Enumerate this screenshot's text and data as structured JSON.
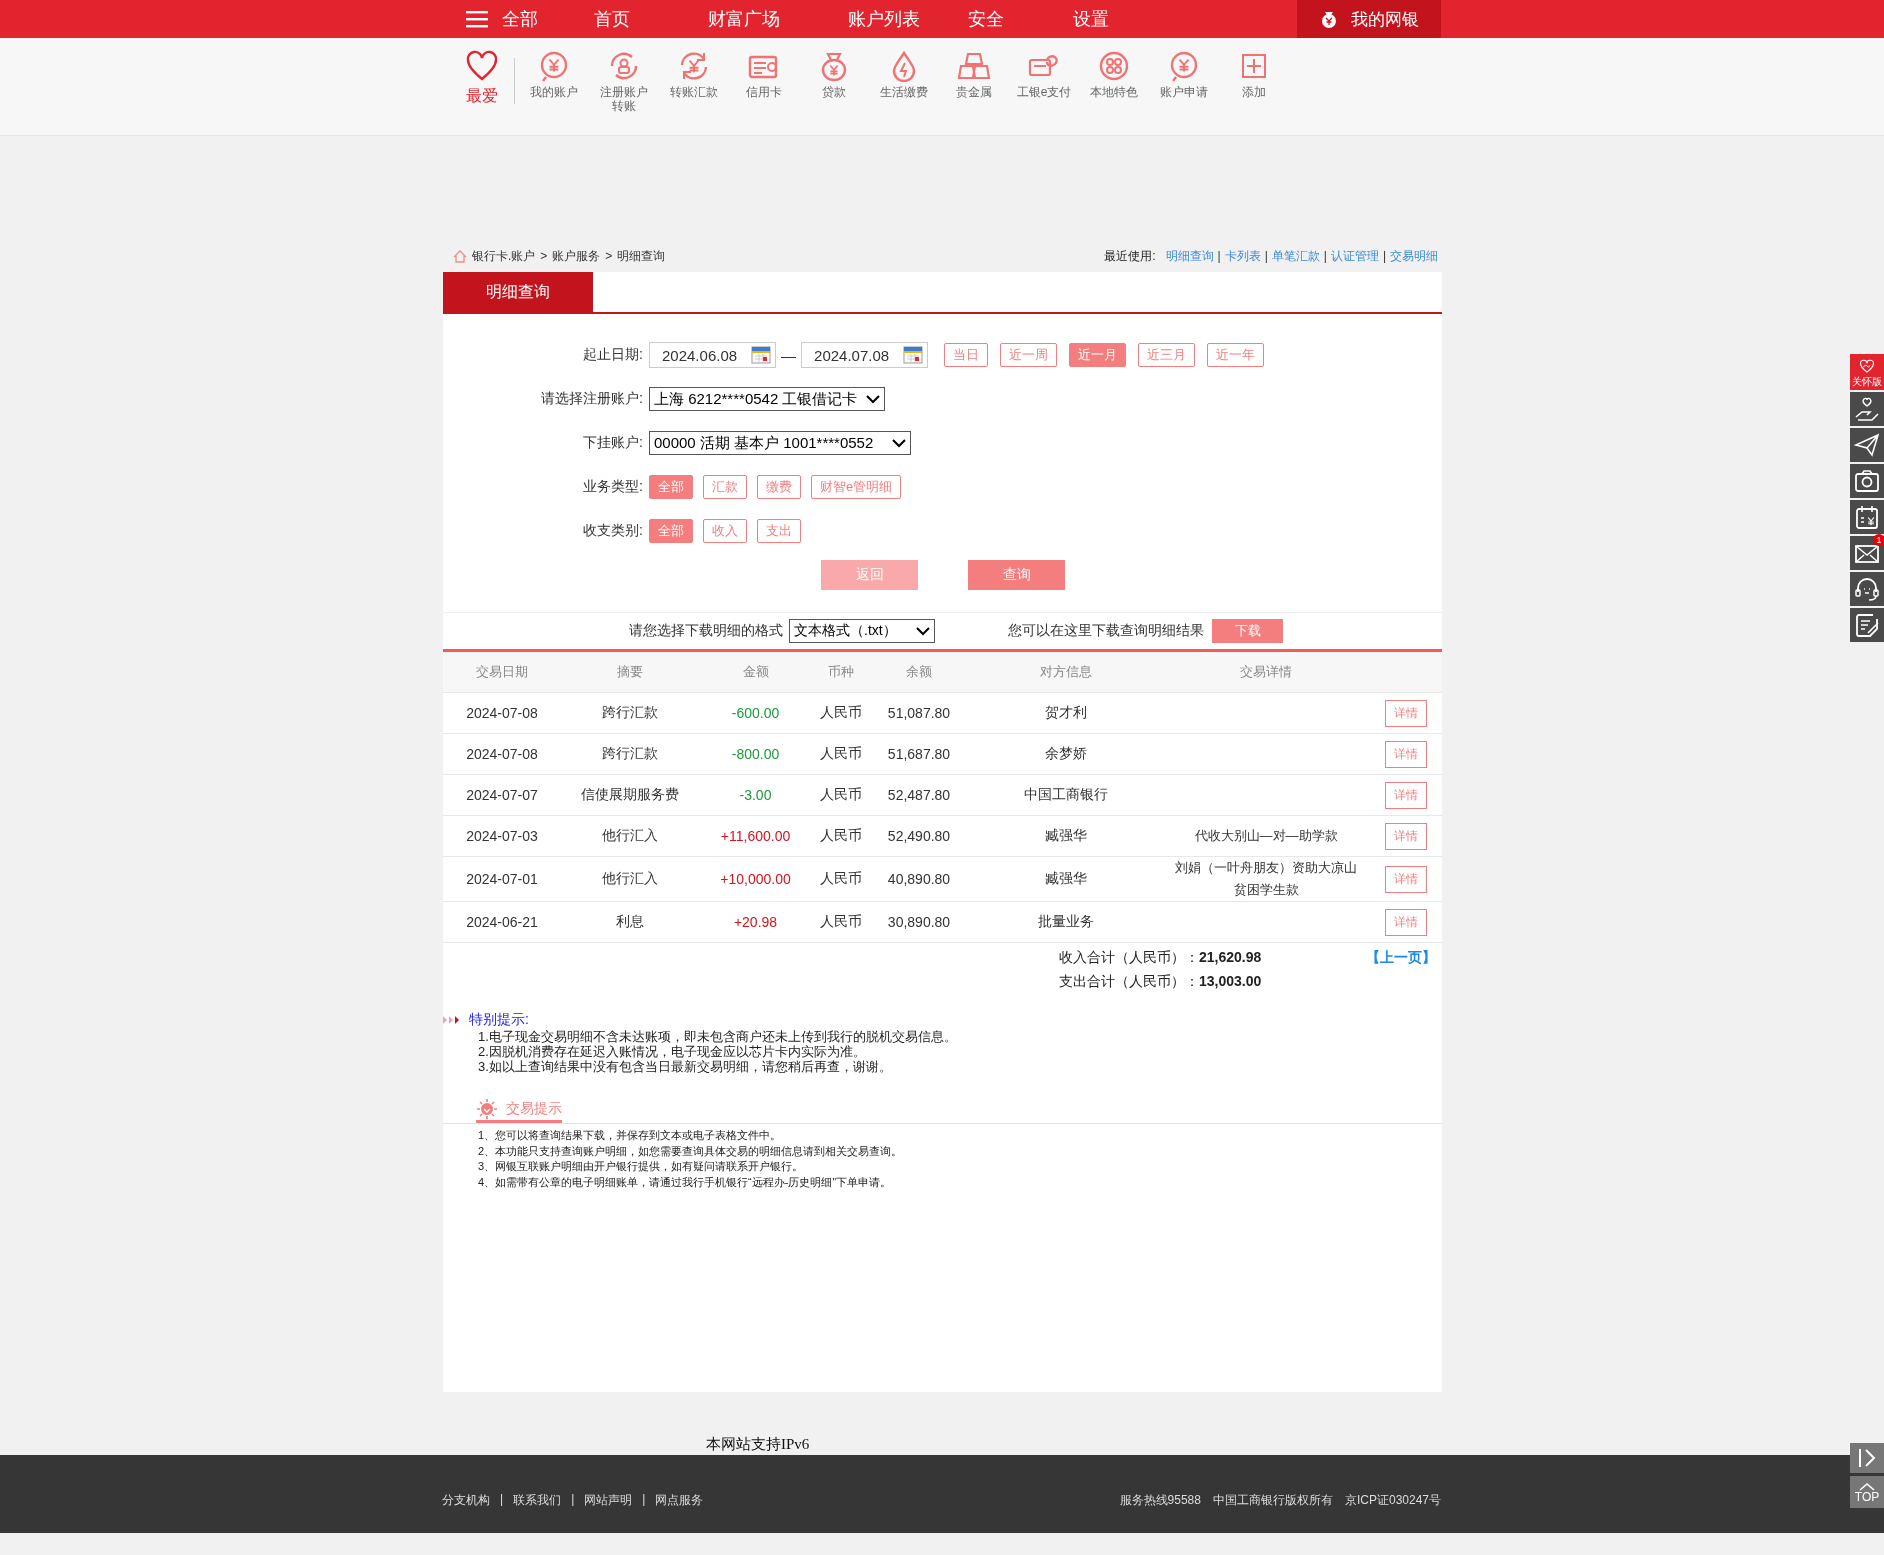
{
  "top_nav": {
    "menu_label": "全部",
    "items": [
      {
        "label": "首页"
      },
      {
        "label": "财富广场"
      },
      {
        "label": "账户列表"
      },
      {
        "label": "安全"
      },
      {
        "label": "设置"
      }
    ],
    "my_bank": "我的网银"
  },
  "quick_menu": {
    "favorite": "最爱",
    "items": [
      {
        "label": "我的账户"
      },
      {
        "label": "注册账户转账"
      },
      {
        "label": "转账汇款"
      },
      {
        "label": "信用卡"
      },
      {
        "label": "贷款"
      },
      {
        "label": "生活缴费"
      },
      {
        "label": "贵金属"
      },
      {
        "label": "工银e支付"
      },
      {
        "label": "本地特色"
      },
      {
        "label": "账户申请"
      },
      {
        "label": "添加"
      }
    ]
  },
  "breadcrumb": {
    "items": [
      "银行卡.账户",
      "账户服务",
      "明细查询"
    ],
    "separator": ">"
  },
  "recent": {
    "label": "最近使用:",
    "links": [
      "明细查询",
      "卡列表",
      "单笔汇款",
      "认证管理",
      "交易明细"
    ],
    "separator": "|"
  },
  "tabs": [
    {
      "label": "明细查询",
      "selected": true
    }
  ],
  "form": {
    "date_label": "起止日期:",
    "start_date": "2024.06.08",
    "dash": "—",
    "end_date": "2024.07.08",
    "ranges": [
      {
        "label": "当日",
        "selected": false
      },
      {
        "label": "近一周",
        "selected": false
      },
      {
        "label": "近一月",
        "selected": true
      },
      {
        "label": "近三月",
        "selected": false
      },
      {
        "label": "近一年",
        "selected": false
      }
    ],
    "account_label": "请选择注册账户:",
    "account": "上海 6212****0542 工银借记卡",
    "sub_account_label": "下挂账户:",
    "sub_account": "00000 活期 基本户 1001****0552",
    "biz_label": "业务类型:",
    "biz_types": [
      {
        "label": "全部",
        "selected": true
      },
      {
        "label": "汇款",
        "selected": false
      },
      {
        "label": "缴费",
        "selected": false
      },
      {
        "label": "财智e管明细",
        "selected": false
      }
    ],
    "io_label": "收支类别:",
    "io_types": [
      {
        "label": "全部",
        "selected": true
      },
      {
        "label": "收入",
        "selected": false
      },
      {
        "label": "支出",
        "selected": false
      }
    ],
    "buttons": [
      {
        "label": "返回",
        "disabled": true
      },
      {
        "label": "查询",
        "disabled": false
      }
    ]
  },
  "download": {
    "label": "请您选择下载明细的格式",
    "format": "文本格式（.txt）",
    "hint": "您可以在这里下载查询明细结果",
    "button": "下载"
  },
  "table": {
    "columns": [
      "交易日期",
      "摘要",
      "金额",
      "币种",
      "余额",
      "对方信息",
      "交易详情"
    ],
    "rows": [
      {
        "date": "2024-07-08",
        "summary": "跨行汇款",
        "amount": "-600.00",
        "color": "#1a9b3a",
        "currency": "人民币",
        "balance": "51,087.80",
        "counterparty": "贺才利",
        "action": "详情"
      },
      {
        "date": "2024-07-08",
        "summary": "跨行汇款",
        "amount": "-800.00",
        "color": "#1a9b3a",
        "currency": "人民币",
        "balance": "51,687.80",
        "counterparty": "余梦娇",
        "action": "详情"
      },
      {
        "date": "2024-07-07",
        "summary": "信使展期服务费",
        "amount": "-3.00",
        "color": "#1a9b3a",
        "currency": "人民币",
        "balance": "52,487.80",
        "counterparty": "中国工商银行",
        "action": "详情"
      },
      {
        "date": "2024-07-03",
        "summary": "他行汇入",
        "amount": "+11,600.00",
        "color": "#d7141e",
        "currency": "人民币",
        "balance": "52,490.80",
        "counterparty": "臧强华",
        "detail": "代收大别山—对—助学款",
        "action": "详情"
      },
      {
        "date": "2024-07-01",
        "summary": "他行汇入",
        "amount": "+10,000.00",
        "color": "#d7141e",
        "currency": "人民币",
        "balance": "40,890.80",
        "counterparty": "臧强华",
        "detail": "刘娟（一叶舟朋友）资助大凉山贫困学生款",
        "action": "详情"
      },
      {
        "date": "2024-06-21",
        "summary": "利息",
        "amount": "+20.98",
        "color": "#d7141e",
        "currency": "人民币",
        "balance": "30,890.80",
        "counterparty": "批量业务",
        "action": "详情"
      }
    ]
  },
  "totals": {
    "income_label": "收入合计（人民币）：",
    "income": "21,620.98",
    "expense_label": "支出合计（人民币）：",
    "expense": "13,003.00",
    "prev_page": "【上一页】"
  },
  "special_tips": {
    "title": "特别提示:",
    "lines": [
      "1.电子现金交易明细不含未达账项，即未包含商户还未上传到我行的脱机交易信息。",
      "2.因脱机消费存在延迟入账情况，电子现金应以芯片卡内实际为准。",
      "3.如以上查询结果中没有包含当日最新交易明细，请您稍后再查，谢谢。"
    ]
  },
  "trade_tips": {
    "title": "交易提示",
    "lines": [
      "1、您可以将查询结果下载，并保存到文本或电子表格文件中。",
      "2、本功能只支持查询账户明细，如您需要查询具体交易的明细信息请到相关交易查询。",
      "3、网银互联账户明细由开户银行提供，如有疑问请联系开户银行。",
      "4、如需带有公章的电子明细账单，请通过我行手机银行“远程办-历史明细”下单申请。"
    ]
  },
  "footer": {
    "ipv6": "本网站支持IPv6",
    "links": [
      "分支机构",
      "联系我们",
      "网站声明",
      "网点服务"
    ],
    "separator": "|",
    "info": [
      "服务热线95588",
      "中国工商银行版权所有",
      "京ICP证030247号"
    ]
  },
  "side_toolbar": {
    "items": [
      {
        "kind": "care",
        "label": "关怀版"
      },
      {
        "kind": "hand"
      },
      {
        "kind": "plane"
      },
      {
        "kind": "camera"
      },
      {
        "kind": "calendar"
      },
      {
        "kind": "mail",
        "badge": "1"
      },
      {
        "kind": "service"
      },
      {
        "kind": "note"
      }
    ],
    "top_label": "TOP"
  }
}
